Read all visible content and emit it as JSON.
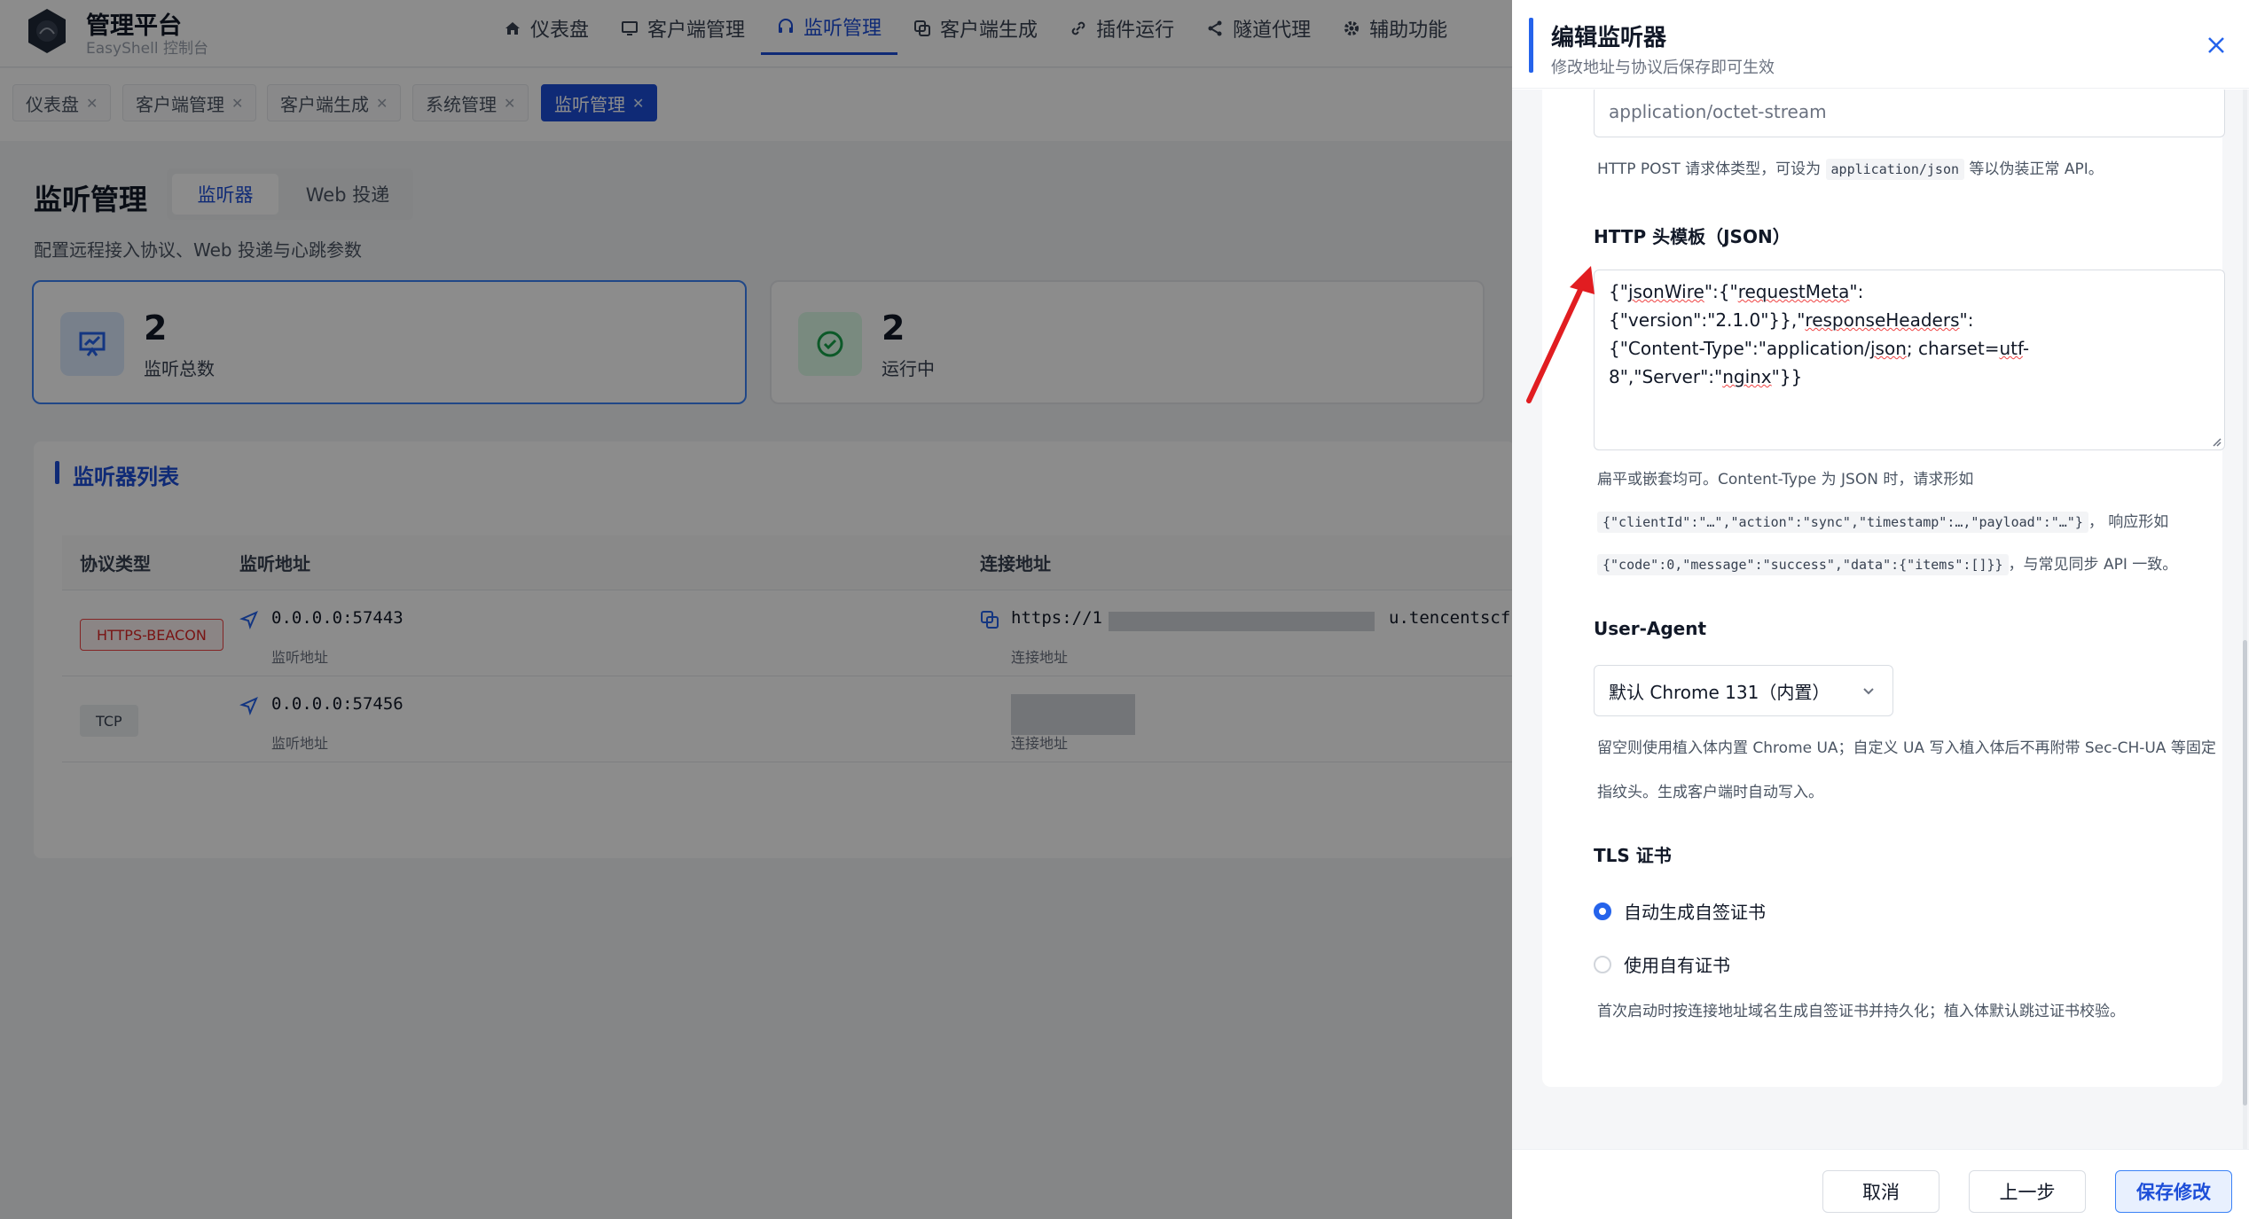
{
  "app": {
    "title": "管理平台",
    "subtitle": "EasyShell 控制台"
  },
  "nav": [
    {
      "label": "仪表盘",
      "icon": "home-icon"
    },
    {
      "label": "客户端管理",
      "icon": "monitor-icon"
    },
    {
      "label": "监听管理",
      "icon": "headset-icon",
      "active": true
    },
    {
      "label": "客户端生成",
      "icon": "copy-icon"
    },
    {
      "label": "插件运行",
      "icon": "link-icon"
    },
    {
      "label": "隧道代理",
      "icon": "share-icon"
    },
    {
      "label": "辅助功能",
      "icon": "gear-icon"
    }
  ],
  "tabs": [
    "仪表盘",
    "客户端管理",
    "客户端生成",
    "系统管理",
    "监听管理"
  ],
  "page": {
    "title": "监听管理",
    "subtabs": [
      "监听器",
      "Web 投递"
    ],
    "description": "配置远程接入协议、Web 投递与心跳参数"
  },
  "stats": [
    {
      "value": "2",
      "label": "监听总数"
    },
    {
      "value": "2",
      "label": "运行中"
    }
  ],
  "list": {
    "title": "监听器列表",
    "columns": [
      "协议类型",
      "监听地址",
      "连接地址"
    ],
    "rows": [
      {
        "protocol": "HTTPS-BEACON",
        "listen": "0.0.0.0:57443",
        "listen_sub": "监听地址",
        "conn_prefix": "https://1",
        "conn_suffix": "u.tencentscf.co",
        "conn_sub": "连接地址"
      },
      {
        "protocol": "TCP",
        "listen": "0.0.0.0:57456",
        "listen_sub": "监听地址",
        "conn_prefix": "",
        "conn_suffix": "",
        "conn_sub": "连接地址"
      }
    ]
  },
  "drawer": {
    "title": "编辑监听器",
    "subtitle": "修改地址与协议后保存即可生效",
    "content_type_value": "application/octet-stream",
    "content_type_hint_pre": "HTTP POST 请求体类型，可设为 ",
    "content_type_hint_code": "application/json",
    "content_type_hint_post": " 等以伪装正常 API。",
    "headers_label": "HTTP 头模板（JSON）",
    "headers_line1_a": "{\"",
    "headers_line1_b": "jsonWire",
    "headers_line1_c": "\":{\"",
    "headers_line1_d": "requestMeta",
    "headers_line1_e": "\":{\"version\":\"2.1.0\"}},\"",
    "headers_line1_f": "responseHeaders",
    "headers_line1_g": "\":",
    "headers_line2_a": "{\"Content-Type\":\"application/",
    "headers_line2_b": "json",
    "headers_line2_c": "; charset=",
    "headers_line2_d": "utf",
    "headers_line2_e": "-8\",\"Server\":\"",
    "headers_line2_f": "nginx",
    "headers_line2_g": "\"}}",
    "headers_hint_1": "扁平或嵌套均可。Content-Type 为 JSON 时，请求形如",
    "headers_hint_code1": "{\"clientId\":\"…\",\"action\":\"sync\",\"timestamp\":…,\"payload\":\"…\"}",
    "headers_hint_mid": "， 响应形如",
    "headers_hint_code2": "{\"code\":0,\"message\":\"success\",\"data\":{\"items\":[]}}",
    "headers_hint_end": "，与常见同步 API 一致。",
    "ua_label": "User-Agent",
    "ua_value": "默认 Chrome 131（内置）",
    "ua_hint": "留空则使用植入体内置 Chrome UA；自定义 UA 写入植入体后不再附带 Sec-CH-UA 等固定指纹头。生成客户端时自动写入。",
    "tls_label": "TLS 证书",
    "tls_options": [
      "自动生成自签证书",
      "使用自有证书"
    ],
    "tls_hint": "首次启动时按连接地址域名生成自签证书并持久化；植入体默认跳过证书校验。",
    "buttons": {
      "cancel": "取消",
      "prev": "上一步",
      "save": "保存修改"
    }
  },
  "colors": {
    "accent": "#1d4ed8",
    "danger": "#dc2626",
    "arrow": "#e11d21"
  }
}
